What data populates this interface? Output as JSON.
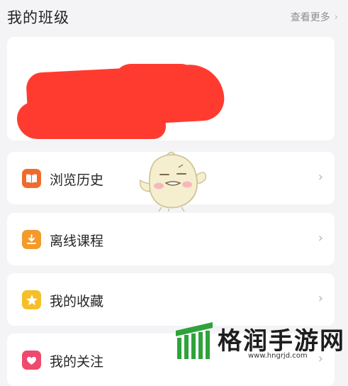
{
  "header": {
    "title": "我的班级",
    "more_label": "查看更多",
    "more_chevron": "›"
  },
  "class_card": {
    "content_state": "redacted"
  },
  "menu": [
    {
      "label": "浏览历史",
      "icon": "book-icon",
      "icon_color": "#f06b2b",
      "chevron": "›"
    },
    {
      "label": "离线课程",
      "icon": "download-icon",
      "icon_color": "#f39a2b",
      "chevron": "›"
    },
    {
      "label": "我的收藏",
      "icon": "star-icon",
      "icon_color": "#f5bf2a",
      "chevron": "›"
    },
    {
      "label": "我的关注",
      "icon": "heart-icon",
      "icon_color": "#ef4a6e",
      "chevron": "›"
    }
  ],
  "watermark": {
    "text": "格润手游网",
    "url": "www.hngrjd.com",
    "logo_color": "#2ea33a"
  },
  "colors": {
    "background": "#f4f4f6",
    "card": "#ffffff",
    "redaction": "#ff3b30",
    "muted_text": "#8d8d8d"
  }
}
